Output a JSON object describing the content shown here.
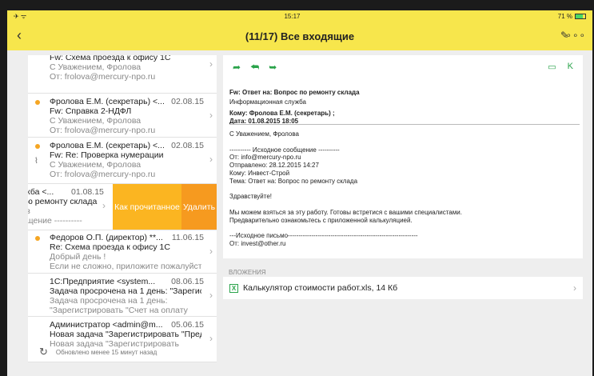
{
  "statusbar": {
    "left": "✈ ᯤ",
    "time": "15:17",
    "battery": "71 %",
    "battery_level": 0.71
  },
  "navbar": {
    "title": "(11/17) Все входящие",
    "back": "‹",
    "edit": "✎",
    "more": "∘∘∘"
  },
  "list": {
    "items": [
      {
        "l1": "",
        "date": "",
        "l2": "Fw: Схема проезда к офису 1С",
        "l3": "С Уважением, Фролова",
        "l4": "От: frolova@mercury-npo.ru",
        "unread": false,
        "clip": false
      },
      {
        "l1": "Фролова Е.М. (секретарь) <...",
        "date": "02.08.15",
        "l2": "Fw: Справка 2-НДФЛ",
        "l3": "С Уважением, Фролова",
        "l4": "От: frolova@mercury-npo.ru",
        "unread": true,
        "clip": false
      },
      {
        "l1": "Фролова Е.М. (секретарь) <...",
        "date": "02.08.15",
        "l2": "Fw: Re: Проверка нумерации",
        "l3": "С Уважением, Фролова",
        "l4": "От: frolova@mercury-npo.ru",
        "unread": true,
        "clip": true
      },
      {
        "l1": "Федоров О.П. (директор) **...",
        "date": "11.06.15",
        "l2": "Re: Схема проезда к офису 1С",
        "l3": "Добрый день !",
        "l4": "Если не сложно, приложите пожалуйста",
        "unread": true,
        "clip": false
      },
      {
        "l1": "1С:Предприятие <system...",
        "date": "08.06.15",
        "l2": "Задача просрочена на 1 день: \"Зарегис...",
        "l3": "Задача просрочена на 1 день:",
        "l4": "\"Зарегистрировать \"Счет на оплату",
        "unread": false,
        "clip": false
      },
      {
        "l1": "Администратор <admin@m...",
        "date": "05.06.15",
        "l2": "Новая задача \"Зарегистрировать \"Пред...",
        "l3": "Новая задача \"Зарегистрировать",
        "l4": "",
        "unread": false,
        "clip": false
      }
    ],
    "swipe": {
      "l1": "кба <...",
      "date": "01.08.15",
      "l2": "ю ремонту склада",
      "l3": "з",
      "l4": "щение ----------",
      "mark_label": "Как прочитанное",
      "delete_label": "Удалить"
    },
    "footer": "Обновлено менее 15 минут назад"
  },
  "detail": {
    "subject": "Fw: Ответ на: Вопрос по ремонту склада",
    "sender": "Информационная служба",
    "to": "Кому: Фролова Е.М. (секретарь) ;",
    "date": "Дата: 01.08.2015 18:05",
    "body": [
      "С Уважением, Фролова",
      "",
      "---------- Исходное сообщение ----------",
      "От: info@mercury-npo.ru",
      "Отправлено: 28.12.2015 14:27",
      "Кому: Инвест-Строй",
      "Тема: Ответ на: Вопрос по ремонту склада",
      "",
      "Здравствуйте!",
      "",
      "Мы можем взяться за эту работу. Готовы встретися с вашими специалистами.",
      "Предварительно ознакомьтесь с приложенной калькуляцией.",
      "",
      "---Исходное письмо-------------------------------------------------------------",
      "От: invest@other.ru"
    ]
  },
  "attachments": {
    "header": "ВЛОЖЕНИЯ",
    "file": "Калькулятор стоимости работ.xls, 14 Кб",
    "icon": "X"
  }
}
